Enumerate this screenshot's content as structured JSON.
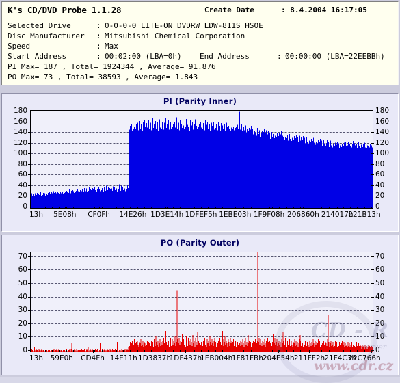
{
  "header": {
    "app_title": "K's CD/DVD Probe 1.1.28",
    "create_date_label": "Create Date",
    "create_date_sep": ":",
    "create_date_value": "8.4.2004 16:17:05",
    "rows": [
      {
        "label": "Selected Drive",
        "sep": ":",
        "value": "0-0-0-0 LITE-ON DVDRW LDW-811S   HSOE"
      },
      {
        "label": "Disc Manufacturer",
        "sep": ":",
        "value": "Mitsubishi Chemical Corporation"
      },
      {
        "label": "Speed",
        "sep": ":",
        "value": "Max"
      }
    ],
    "address_row": {
      "label": "Start Address",
      "sep": ":",
      "value": "00:02:00 (LBA=0h)",
      "label2": "End Address",
      "sep2": ":",
      "value2": "00:00:00 (LBA=22EEBBh)"
    },
    "pi_summary": "PI Max= 187 , Total= 1924344 , Average= 91.876",
    "po_summary": "PO Max= 73 , Total= 38593 , Average= 1.843"
  },
  "watermark": {
    "brand": "CD - R",
    "sub": "server",
    "url": "www.cdr.cz"
  },
  "colors": {
    "pi_bar": "#0000e6",
    "po_bar": "#e60000",
    "plot_bg": "#f0f0fa",
    "panel_bg": "#e9e9f8",
    "header_bg": "#ffffef",
    "title_text": "#000060",
    "grid": "#555570"
  },
  "chart_data": [
    {
      "type": "bar",
      "id": "pi",
      "title": "PI (Parity Inner)",
      "xlabel": "",
      "ylabel": "",
      "ylim": [
        0,
        180
      ],
      "yticks": [
        0,
        20,
        40,
        60,
        80,
        100,
        120,
        140,
        160,
        180
      ],
      "grid": true,
      "legend": "none",
      "bar_color": "#0000e6",
      "xtick_labels": [
        "13h",
        "5E08h",
        "CF0Fh",
        "14E26h",
        "1D3E14h",
        "1DFEF5h",
        "1EBE03h",
        "1F9F08h",
        "206860h",
        "214017h",
        "221B13h"
      ],
      "summary": {
        "max": 187,
        "total": 1924344,
        "average": 91.876
      },
      "values": [
        24,
        27,
        22,
        26,
        29,
        23,
        27,
        25,
        24,
        28,
        22,
        26,
        24,
        27,
        29,
        23,
        26,
        24,
        28,
        25,
        27,
        23,
        29,
        26,
        24,
        28,
        25,
        30,
        26,
        24,
        29,
        27,
        25,
        31,
        28,
        26,
        30,
        27,
        25,
        29,
        28,
        32,
        26,
        30,
        27,
        31,
        29,
        26,
        33,
        28,
        30,
        27,
        32,
        29,
        31,
        28,
        34,
        30,
        27,
        32,
        29,
        33,
        31,
        28,
        35,
        30,
        32,
        29,
        34,
        31,
        36,
        30,
        33,
        28,
        31,
        35,
        32,
        30,
        37,
        33,
        31,
        36,
        30,
        34,
        32,
        38,
        31,
        35,
        33,
        29,
        37,
        34,
        31,
        39,
        33,
        36,
        30,
        34,
        32,
        38,
        35,
        31,
        40,
        33,
        37,
        34,
        30,
        38,
        36,
        32,
        41,
        35,
        33,
        39,
        31,
        37,
        34,
        43,
        36,
        32,
        40,
        35,
        38,
        33,
        42,
        36,
        30,
        39,
        34,
        44,
        37,
        32,
        41,
        35,
        38,
        33,
        40,
        36,
        31,
        39,
        34,
        42,
        37,
        30,
        145,
        152,
        148,
        156,
        143,
        160,
        147,
        151,
        164,
        146,
        155,
        149,
        158,
        144,
        152,
        161,
        147,
        156,
        150,
        143,
        159,
        148,
        163,
        151,
        145,
        157,
        149,
        154,
        162,
        147,
        151,
        158,
        144,
        153,
        166,
        148,
        155,
        150,
        161,
        146,
        152,
        159,
        143,
        157,
        164,
        149,
        153,
        147,
        160,
        151,
        145,
        158,
        154,
        167,
        148,
        156,
        150,
        162,
        145,
        153,
        159,
        147,
        165,
        151,
        156,
        143,
        160,
        149,
        154,
        168,
        147,
        152,
        158,
        144,
        163,
        150,
        155,
        148,
        161,
        153,
        146,
        159,
        151,
        165,
        147,
        154,
        150,
        157,
        143,
        162,
        148,
        153,
        159,
        145,
        150,
        156,
        164,
        148,
        152,
        146,
        158,
        151,
        155,
        143,
        160,
        149,
        153,
        147,
        157,
        150,
        144,
        162,
        148,
        154,
        159,
        146,
        151,
        155,
        143,
        149,
        158,
        152,
        147,
        160,
        145,
        153,
        148,
        156,
        150,
        144,
        159,
        147,
        152,
        142,
        157,
        149,
        153,
        146,
        151,
        155,
        143,
        148,
        158,
        150,
        144,
        152,
        147,
        156,
        142,
        149,
        153,
        146,
        151,
        144,
        157,
        148,
        150,
        143,
        154,
        147,
        141,
        152,
        145,
        149,
        156,
        142,
        148,
        151,
        144,
        147,
        153,
        140,
        146,
        150,
        143,
        148,
        138,
        145,
        152,
        141,
        147,
        136,
        150,
        143,
        139,
        146,
        134,
        148,
        141,
        137,
        144,
        132,
        146,
        139,
        143,
        135,
        141,
        147,
        133,
        138,
        144,
        130,
        136,
        142,
        134,
        139,
        128,
        135,
        141,
        131,
        137,
        143,
        129,
        134,
        140,
        132,
        138,
        127,
        133,
        139,
        130,
        136,
        142,
        128,
        134,
        131,
        137,
        126,
        132,
        138,
        129,
        135,
        125,
        131,
        137,
        128,
        134,
        124,
        130,
        136,
        127,
        133,
        123,
        129,
        135,
        126,
        132,
        122,
        128,
        134,
        125,
        131,
        121,
        127,
        133,
        124,
        130,
        120,
        126,
        132,
        123,
        129,
        119,
        125,
        131,
        122,
        128,
        118,
        124,
        130,
        121,
        127,
        117,
        123,
        129,
        120,
        126,
        116,
        122,
        128,
        119,
        125,
        115,
        121,
        127,
        118,
        124,
        114,
        120,
        126,
        117,
        123,
        113,
        119,
        125,
        116,
        122,
        112,
        118,
        124,
        115,
        121,
        111,
        117,
        123,
        114,
        120,
        110,
        116,
        122,
        113,
        119,
        125,
        115,
        121,
        117,
        123,
        114,
        120,
        116,
        122,
        113,
        119,
        115,
        121,
        112,
        118,
        124,
        114,
        120,
        116,
        112,
        118,
        110,
        116,
        122,
        114,
        120,
        111,
        117,
        123,
        113,
        119,
        115,
        121,
        112,
        118,
        110,
        116,
        114,
        120,
        112,
        118,
        110,
        116,
        112
      ],
      "spikes": [
        {
          "index": 305,
          "value": 178
        },
        {
          "index": 418,
          "value": 180
        }
      ]
    },
    {
      "type": "bar",
      "id": "po",
      "title": "PO (Parity Outer)",
      "xlabel": "",
      "ylabel": "",
      "ylim": [
        0,
        73
      ],
      "yticks": [
        0,
        10,
        20,
        30,
        40,
        50,
        60,
        70
      ],
      "grid": true,
      "legend": "none",
      "bar_color": "#e60000",
      "xtick_labels": [
        "13h",
        "59E0h",
        "CD4Fh",
        "14E11h",
        "1D3837h",
        "1DF437h",
        "1EB004h",
        "1F81FBh",
        "204E54h",
        "211FF2h",
        "21F4C3h",
        "22C766h"
      ],
      "summary": {
        "max": 73,
        "total": 38593,
        "average": 1.843
      },
      "values": [
        1,
        2,
        1,
        0,
        1,
        3,
        1,
        0,
        2,
        1,
        1,
        0,
        2,
        1,
        0,
        1,
        2,
        0,
        1,
        1,
        2,
        0,
        1,
        3,
        1,
        0,
        1,
        2,
        1,
        0,
        2,
        1,
        1,
        0,
        1,
        2,
        0,
        1,
        1,
        2,
        0,
        1,
        2,
        1,
        0,
        1,
        1,
        2,
        0,
        1,
        2,
        1,
        0,
        1,
        2,
        0,
        1,
        1,
        2,
        1,
        0,
        2,
        1,
        1,
        0,
        1,
        2,
        1,
        0,
        2,
        1,
        0,
        1,
        2,
        1,
        1,
        0,
        2,
        1,
        0,
        1,
        2,
        1,
        0,
        1,
        2,
        1,
        3,
        0,
        1,
        2,
        1,
        0,
        2,
        1,
        1,
        0,
        1,
        2,
        0,
        1,
        2,
        1,
        0,
        1,
        2,
        1,
        0,
        2,
        1,
        0,
        1,
        2,
        1,
        0,
        1,
        2,
        1,
        1,
        0,
        2,
        1,
        0,
        1,
        2,
        1,
        0,
        1,
        2,
        0,
        1,
        2,
        1,
        0,
        1,
        2,
        1,
        0,
        2,
        1,
        1,
        0,
        1,
        2,
        0,
        1,
        2,
        1,
        3,
        5,
        4,
        7,
        3,
        6,
        8,
        4,
        5,
        9,
        3,
        6,
        7,
        4,
        8,
        5,
        3,
        7,
        6,
        9,
        4,
        5,
        8,
        3,
        7,
        6,
        4,
        9,
        5,
        8,
        3,
        7,
        6,
        10,
        4,
        8,
        5,
        7,
        3,
        9,
        6,
        4,
        11,
        7,
        5,
        8,
        3,
        6,
        9,
        4,
        7,
        5,
        8,
        3,
        10,
        6,
        4,
        9,
        7,
        5,
        12,
        8,
        3,
        6,
        10,
        4,
        7,
        9,
        5,
        8,
        6,
        11,
        4,
        7,
        3,
        9,
        6,
        10,
        5,
        8,
        4,
        7,
        13,
        6,
        9,
        5,
        8,
        3,
        11,
        7,
        4,
        10,
        6,
        8,
        5,
        9,
        7,
        4,
        12,
        6,
        8,
        3,
        10,
        7,
        5,
        9,
        4,
        8,
        6,
        11,
        5,
        7,
        9,
        4,
        8,
        6,
        10,
        5,
        7,
        3,
        9,
        6,
        8,
        4,
        11,
        7,
        5,
        9,
        6,
        4,
        8,
        10,
        5,
        7,
        3,
        9,
        6,
        8,
        4,
        10,
        7,
        5,
        8,
        6,
        9,
        4,
        7,
        11,
        5,
        8,
        6,
        3,
        9,
        7,
        4,
        10,
        6,
        8,
        5,
        7,
        9,
        4,
        6,
        8,
        3,
        10,
        7,
        5,
        9,
        6,
        4,
        8,
        7,
        5,
        9,
        6,
        3,
        8,
        10,
        5,
        7,
        4,
        9,
        6,
        8,
        5,
        7,
        3,
        10,
        6,
        8,
        4,
        7,
        9,
        5,
        6,
        8,
        3,
        7,
        10,
        5,
        9,
        6,
        4,
        8,
        7,
        5,
        9,
        3,
        6,
        8,
        4,
        10,
        7,
        5,
        8,
        6,
        9,
        4,
        7,
        3,
        8,
        6,
        10,
        5,
        7,
        9,
        4,
        6,
        8,
        5,
        7,
        3,
        9,
        6,
        4,
        8,
        7,
        5,
        10,
        6,
        3,
        8,
        5,
        7,
        9,
        4,
        6,
        8,
        5,
        3,
        7,
        6,
        9,
        4,
        8,
        5,
        7,
        3,
        6,
        9,
        5,
        8,
        4,
        7,
        6,
        3,
        9,
        5,
        8,
        6,
        4,
        7,
        9,
        5,
        3,
        8,
        6,
        4,
        7,
        5,
        9,
        6,
        3,
        8,
        5,
        7,
        4,
        6,
        9,
        5,
        8,
        3,
        7,
        5,
        6,
        4,
        8,
        5,
        3,
        7,
        6,
        4,
        9,
        5,
        7,
        3,
        6,
        8,
        4,
        5,
        7,
        3,
        6,
        4,
        8,
        5,
        7,
        3,
        6,
        4,
        7,
        5,
        3,
        6,
        8,
        4,
        5,
        7,
        3,
        6,
        4,
        5,
        3,
        7,
        4,
        6,
        3,
        5,
        4,
        7,
        3,
        5,
        6,
        4,
        3,
        5,
        7,
        4,
        3,
        6,
        4,
        3,
        5,
        4,
        2,
        5,
        3,
        4,
        2,
        5,
        3,
        4,
        2,
        3,
        5,
        2,
        4,
        3,
        2,
        4,
        3
      ],
      "spikes": [
        {
          "index": 222,
          "value": 45
        },
        {
          "index": 345,
          "value": 73
        },
        {
          "index": 452,
          "value": 27
        },
        {
          "index": 205,
          "value": 15
        },
        {
          "index": 253,
          "value": 14
        },
        {
          "index": 291,
          "value": 15
        },
        {
          "index": 313,
          "value": 14
        },
        {
          "index": 330,
          "value": 12
        },
        {
          "index": 368,
          "value": 13
        },
        {
          "index": 383,
          "value": 14
        },
        {
          "index": 409,
          "value": 12
        },
        {
          "index": 23,
          "value": 7
        },
        {
          "index": 62,
          "value": 6
        },
        {
          "index": 105,
          "value": 6
        },
        {
          "index": 131,
          "value": 7
        }
      ]
    }
  ]
}
